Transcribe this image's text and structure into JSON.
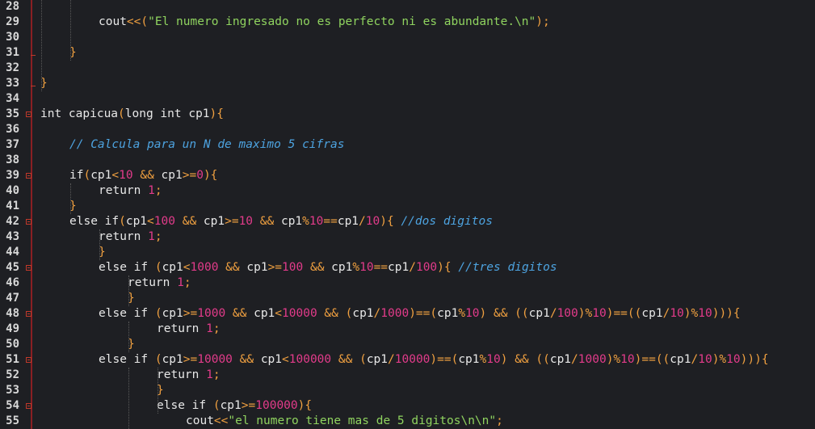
{
  "editor": {
    "lines": [
      {
        "n": "28",
        "t": []
      },
      {
        "n": "29",
        "i": 2,
        "t": [
          [
            "id",
            "cout"
          ],
          [
            "op",
            "<<("
          ],
          [
            "str",
            "\"El numero ingresado no es perfecto ni es abundante.\\n\""
          ],
          [
            "op",
            ");"
          ]
        ]
      },
      {
        "n": "30",
        "t": []
      },
      {
        "n": "31",
        "i": 1,
        "t": [
          [
            "op",
            "}"
          ]
        ]
      },
      {
        "n": "32",
        "t": []
      },
      {
        "n": "33",
        "i": 0,
        "t": [
          [
            "op",
            "}"
          ]
        ]
      },
      {
        "n": "34",
        "t": []
      },
      {
        "n": "35",
        "i": 0,
        "t": [
          [
            "kw",
            "int "
          ],
          [
            "fn",
            "capicua"
          ],
          [
            "op",
            "("
          ],
          [
            "kw",
            "long int "
          ],
          [
            "id",
            "cp1"
          ],
          [
            "op",
            "){"
          ]
        ]
      },
      {
        "n": "36",
        "t": []
      },
      {
        "n": "37",
        "i": 1,
        "t": [
          [
            "cmt",
            "// Calcula para un N de maximo 5 cifras"
          ]
        ]
      },
      {
        "n": "38",
        "t": []
      },
      {
        "n": "39",
        "i": 1,
        "t": [
          [
            "kw",
            "if"
          ],
          [
            "op",
            "("
          ],
          [
            "id",
            "cp1"
          ],
          [
            "op",
            "<"
          ],
          [
            "num",
            "10"
          ],
          [
            "op",
            " && "
          ],
          [
            "id",
            "cp1"
          ],
          [
            "op",
            ">="
          ],
          [
            "num",
            "0"
          ],
          [
            "op",
            "){"
          ]
        ]
      },
      {
        "n": "40",
        "i": 2,
        "t": [
          [
            "kw",
            "return "
          ],
          [
            "num",
            "1"
          ],
          [
            "op",
            ";"
          ]
        ]
      },
      {
        "n": "41",
        "i": 1,
        "t": [
          [
            "op",
            "}"
          ]
        ]
      },
      {
        "n": "42",
        "i": 1,
        "t": [
          [
            "kw",
            "else if"
          ],
          [
            "op",
            "("
          ],
          [
            "id",
            "cp1"
          ],
          [
            "op",
            "<"
          ],
          [
            "num",
            "100"
          ],
          [
            "op",
            " && "
          ],
          [
            "id",
            "cp1"
          ],
          [
            "op",
            ">="
          ],
          [
            "num",
            "10"
          ],
          [
            "op",
            " && "
          ],
          [
            "id",
            "cp1"
          ],
          [
            "op",
            "%"
          ],
          [
            "num",
            "10"
          ],
          [
            "op",
            "=="
          ],
          [
            "id",
            "cp1"
          ],
          [
            "op",
            "/"
          ],
          [
            "num",
            "10"
          ],
          [
            "op",
            "){ "
          ],
          [
            "cmt",
            "//dos digitos"
          ]
        ]
      },
      {
        "n": "43",
        "i": 2,
        "t": [
          [
            "kw",
            "return "
          ],
          [
            "num",
            "1"
          ],
          [
            "op",
            ";"
          ]
        ]
      },
      {
        "n": "44",
        "i": 2,
        "t": [
          [
            "op",
            "}"
          ]
        ]
      },
      {
        "n": "45",
        "i": 2,
        "t": [
          [
            "kw",
            "else if "
          ],
          [
            "op",
            "("
          ],
          [
            "id",
            "cp1"
          ],
          [
            "op",
            "<"
          ],
          [
            "num",
            "1000"
          ],
          [
            "op",
            " && "
          ],
          [
            "id",
            "cp1"
          ],
          [
            "op",
            ">="
          ],
          [
            "num",
            "100"
          ],
          [
            "op",
            " && "
          ],
          [
            "id",
            "cp1"
          ],
          [
            "op",
            "%"
          ],
          [
            "num",
            "10"
          ],
          [
            "op",
            "=="
          ],
          [
            "id",
            "cp1"
          ],
          [
            "op",
            "/"
          ],
          [
            "num",
            "100"
          ],
          [
            "op",
            "){ "
          ],
          [
            "cmt",
            "//tres digitos"
          ]
        ]
      },
      {
        "n": "46",
        "i": 3,
        "t": [
          [
            "kw",
            "return "
          ],
          [
            "num",
            "1"
          ],
          [
            "op",
            ";"
          ]
        ]
      },
      {
        "n": "47",
        "i": 3,
        "t": [
          [
            "op",
            "}"
          ]
        ]
      },
      {
        "n": "48",
        "i": 2,
        "t": [
          [
            "kw",
            "else if "
          ],
          [
            "op",
            "("
          ],
          [
            "id",
            "cp1"
          ],
          [
            "op",
            ">="
          ],
          [
            "num",
            "1000"
          ],
          [
            "op",
            " && "
          ],
          [
            "id",
            "cp1"
          ],
          [
            "op",
            "<"
          ],
          [
            "num",
            "10000"
          ],
          [
            "op",
            " && ("
          ],
          [
            "id",
            "cp1"
          ],
          [
            "op",
            "/"
          ],
          [
            "num",
            "1000"
          ],
          [
            "op",
            ")==("
          ],
          [
            "id",
            "cp1"
          ],
          [
            "op",
            "%"
          ],
          [
            "num",
            "10"
          ],
          [
            "op",
            ") && (("
          ],
          [
            "id",
            "cp1"
          ],
          [
            "op",
            "/"
          ],
          [
            "num",
            "100"
          ],
          [
            "op",
            ")%"
          ],
          [
            "num",
            "10"
          ],
          [
            "op",
            ")==(("
          ],
          [
            "id",
            "cp1"
          ],
          [
            "op",
            "/"
          ],
          [
            "num",
            "10"
          ],
          [
            "op",
            ")%"
          ],
          [
            "num",
            "10"
          ],
          [
            "op",
            "))){"
          ]
        ]
      },
      {
        "n": "49",
        "i": 4,
        "t": [
          [
            "kw",
            "return "
          ],
          [
            "num",
            "1"
          ],
          [
            "op",
            ";"
          ]
        ]
      },
      {
        "n": "50",
        "i": 3,
        "t": [
          [
            "op",
            "}"
          ]
        ]
      },
      {
        "n": "51",
        "i": 2,
        "t": [
          [
            "kw",
            "else if "
          ],
          [
            "op",
            "("
          ],
          [
            "id",
            "cp1"
          ],
          [
            "op",
            ">="
          ],
          [
            "num",
            "10000"
          ],
          [
            "op",
            " && "
          ],
          [
            "id",
            "cp1"
          ],
          [
            "op",
            "<"
          ],
          [
            "num",
            "100000"
          ],
          [
            "op",
            " && ("
          ],
          [
            "id",
            "cp1"
          ],
          [
            "op",
            "/"
          ],
          [
            "num",
            "10000"
          ],
          [
            "op",
            ")==("
          ],
          [
            "id",
            "cp1"
          ],
          [
            "op",
            "%"
          ],
          [
            "num",
            "10"
          ],
          [
            "op",
            ") && (("
          ],
          [
            "id",
            "cp1"
          ],
          [
            "op",
            "/"
          ],
          [
            "num",
            "1000"
          ],
          [
            "op",
            ")%"
          ],
          [
            "num",
            "10"
          ],
          [
            "op",
            ")==(("
          ],
          [
            "id",
            "cp1"
          ],
          [
            "op",
            "/"
          ],
          [
            "num",
            "10"
          ],
          [
            "op",
            ")%"
          ],
          [
            "num",
            "10"
          ],
          [
            "op",
            "))){"
          ]
        ]
      },
      {
        "n": "52",
        "i": 4,
        "t": [
          [
            "kw",
            "return "
          ],
          [
            "num",
            "1"
          ],
          [
            "op",
            ";"
          ]
        ]
      },
      {
        "n": "53",
        "i": 4,
        "t": [
          [
            "op",
            "}"
          ]
        ]
      },
      {
        "n": "54",
        "i": 4,
        "t": [
          [
            "kw",
            "else if "
          ],
          [
            "op",
            "("
          ],
          [
            "id",
            "cp1"
          ],
          [
            "op",
            ">="
          ],
          [
            "num",
            "100000"
          ],
          [
            "op",
            "){"
          ]
        ]
      },
      {
        "n": "55",
        "i": 5,
        "t": [
          [
            "id",
            "cout"
          ],
          [
            "op",
            "<<"
          ],
          [
            "str",
            "\"el numero tiene mas de 5 digitos\\n\\n\""
          ],
          [
            "op",
            ";"
          ]
        ]
      }
    ]
  }
}
